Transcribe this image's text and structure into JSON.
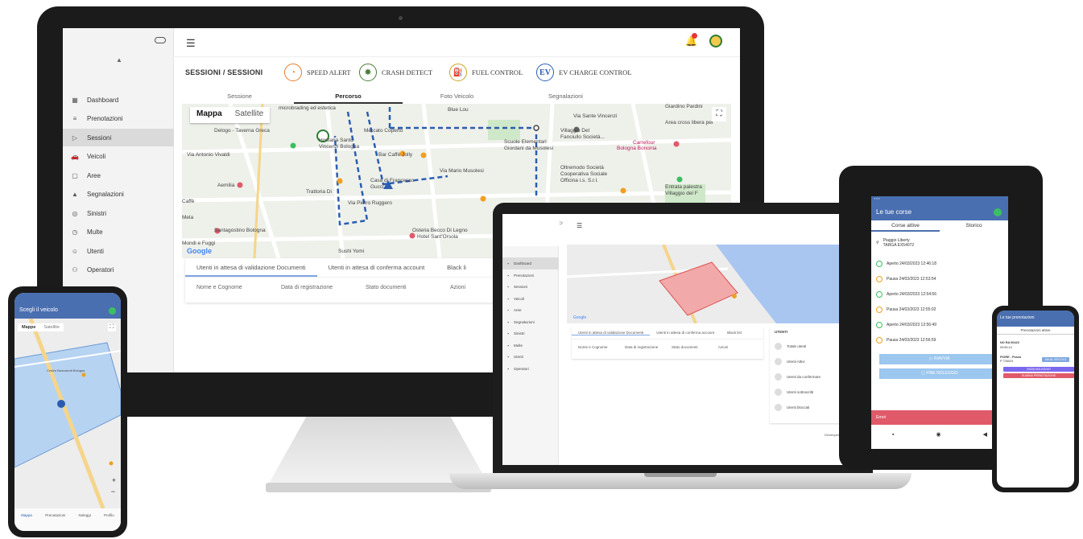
{
  "desktop": {
    "breadcrumb": "SESSIONI  /  SESSIONI",
    "features": [
      {
        "label": "SPEED ALERT",
        "icon": "speedometer-icon",
        "color": "#e57c2b"
      },
      {
        "label": "CRASH DETECT",
        "icon": "car-crash-icon",
        "color": "#4a7c3a"
      },
      {
        "label": "FUEL CONTROL",
        "icon": "fuel-pump-icon",
        "color": "#c9a227"
      },
      {
        "label": "EV CHARGE CONTROL",
        "icon": "ev-charge-icon",
        "color": "#2a5db0",
        "glyph": "EV"
      }
    ],
    "sidebar": [
      {
        "label": "Dashboard",
        "icon": "grid-icon"
      },
      {
        "label": "Prenotazioni",
        "icon": "list-icon"
      },
      {
        "label": "Sessioni",
        "icon": "play-icon"
      },
      {
        "label": "Veicoli",
        "icon": "car-icon"
      },
      {
        "label": "Aree",
        "icon": "area-icon"
      },
      {
        "label": "Segnalazioni",
        "icon": "warning-icon"
      },
      {
        "label": "Sinistri",
        "icon": "accident-icon"
      },
      {
        "label": "Multe",
        "icon": "ticket-icon"
      },
      {
        "label": "Utenti",
        "icon": "user-icon"
      },
      {
        "label": "Operatori",
        "icon": "operators-icon"
      }
    ],
    "tabs": [
      "Sessione",
      "Percorso",
      "Foto Veicolo",
      "Segnalazioni"
    ],
    "map_toggle": {
      "on": "Mappa",
      "off": "Satellite"
    },
    "map_labels": [
      "microbrading ed estetica",
      "Blue Lou",
      "Giardino Pardini",
      "Via Sante Vincenzi",
      "Area cross libera per",
      "Villaggio Del",
      "Fanciullo Società...",
      "Carrefour",
      "Bologna Bononia",
      "Delogo - Taverna Greca",
      "Hostaria Santo",
      "Vincenzi Bologna",
      "Mercato Coperto",
      "Bar Caffé Jolly",
      "Scuole Elementari",
      "Giordani da Musolesi",
      "Via Mario Musolesi",
      "Oltremodo Società",
      "Cooperativa Sociale",
      "Officina i.s. S.r.l.",
      "Entrata palestra",
      "Villaggio del F",
      "Aemilia",
      "Trattoria Di",
      "Casa di Francesco",
      "Gucci",
      "Santagostino Bologna",
      "Osteria Becco Di Legno",
      "Hotel Sant'Orsola",
      "Mondi e Fuggi",
      "Sushi Yomi",
      "Google",
      "Via Antonio Vivaldi",
      "Via Pietro Ruggero",
      "Caffè",
      "Mela"
    ],
    "panel_tabs": [
      "Utenti in attesa di validazione Documenti",
      "Utenti in attesa di conferma account",
      "Black li"
    ],
    "panel_cols": [
      "Nome e Cognome",
      "Data di registrazione",
      "Stato documenti",
      "Azioni"
    ]
  },
  "laptop": {
    "sidebar": [
      "Dashboard",
      "Prenotazioni",
      "Sessioni",
      "Veicoli",
      "Aree",
      "Segnalazioni",
      "Sinistri",
      "Multe",
      "Utenti",
      "Operatori"
    ],
    "panel_tabs": [
      "Utenti in attesa di validazione Documenti",
      "Utenti in attesa di conferma account",
      "Black list"
    ],
    "panel_cols": [
      "Nome e Cognome",
      "Data di registrazione",
      "Stato documenti",
      "Azioni"
    ],
    "users_title": "UTENTI",
    "users": [
      "Totale utenti",
      "Utenti Attivi",
      "Utenti da confermare",
      "Utenti sottoscritti",
      "Utenti bloccati"
    ],
    "footer": "Developed by: ONE2"
  },
  "tablet": {
    "title": "Le tue corse",
    "tabs": [
      "Corse attive",
      "Storico"
    ],
    "vehicle": "Piaggio Liberty",
    "plate": "TARGA EX54072",
    "events": [
      {
        "label": "Aperto 24/03/2023 12:46:18",
        "color": "#3ac060"
      },
      {
        "label": "Pausa 24/03/2023 12:53:54",
        "color": "#f0a020"
      },
      {
        "label": "Aperto 24/03/2023 12:54:56",
        "color": "#3ac060"
      },
      {
        "label": "Pausa 24/03/2023 12:55:02",
        "color": "#f0a020"
      },
      {
        "label": "Aperto 24/03/2023 12:56:49",
        "color": "#3ac060"
      },
      {
        "label": "Pausa 24/03/2023 12:56:59",
        "color": "#f0a020"
      }
    ],
    "btn_resume": "▷  RIAVVIA",
    "btn_end": "▢  FINE NOLEGGIO",
    "error": "Errori"
  },
  "phone_right": {
    "title": "Le tue prenotazioni",
    "subtitle": "Prenotazioni attive",
    "plate": "NO RA 00423",
    "time": "09:55:14",
    "model": "FIORE - Poseu",
    "code": "P 726024",
    "btn_vehicle": "VAI AL VEICOLO",
    "btn_start": "INIZIA NOLEGGIO",
    "btn_delete": "ELIMINA PRENOTAZIONE"
  },
  "phone_left": {
    "title": "Scegli il veicolo",
    "map_toggle": {
      "on": "Mappe",
      "off": "Satellite"
    },
    "map_label": "Centro Buonarroti Bologna",
    "nav": [
      "Mappa",
      "Prenotazioni",
      "Noleggi",
      "Profilo"
    ]
  },
  "colors": {
    "brand_blue": "#4a6fb0",
    "route_blue": "#2a5db0",
    "active_green": "#3ac060",
    "pause_orange": "#f0a020",
    "error_red": "#e05a6a"
  }
}
